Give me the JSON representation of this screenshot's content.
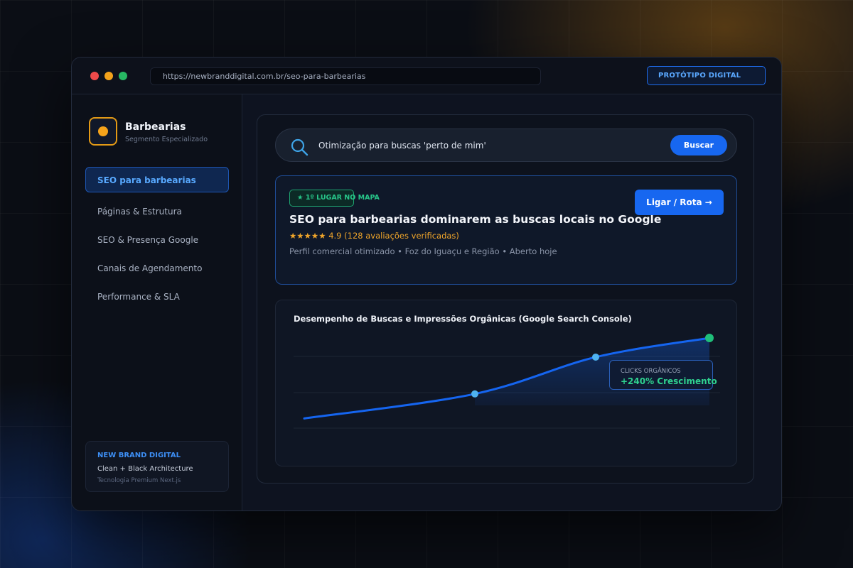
{
  "browser": {
    "url": "https://newbranddigital.com.br/seo-para-barbearias",
    "badge": "PROTÓTIPO DIGITAL"
  },
  "sidebar": {
    "brand_title": "Barbearias",
    "brand_subtitle": "Segmento Especializado",
    "items": [
      {
        "label": "SEO para barbearias",
        "active": true
      },
      {
        "label": "Páginas & Estrutura",
        "active": false
      },
      {
        "label": "SEO & Presença Google",
        "active": false
      },
      {
        "label": "Canais de Agendamento",
        "active": false
      },
      {
        "label": "Performance & SLA",
        "active": false
      }
    ],
    "footer": {
      "title": "NEW BRAND DIGITAL",
      "line1": "Clean + Black Architecture",
      "line2": "Tecnologia Premium Next.js"
    }
  },
  "search": {
    "query": "Otimização para buscas 'perto de mim'",
    "button": "Buscar"
  },
  "result": {
    "badge": "★ 1º LUGAR NO MAPA",
    "title": "SEO para barbearias dominarem as buscas locais no Google",
    "rating": "★★★★★ 4.9 (128 avaliações verificadas)",
    "meta": "Perfil comercial otimizado • Foz do Iguaçu e Região • Aberto hoje",
    "cta": "Ligar / Rota →"
  },
  "chart": {
    "title": "Desempenho de Buscas e Impressões Orgânicas (Google Search Console)",
    "callout_label": "CLICKS ORGÂNICOS",
    "callout_value": "+240% Crescimento"
  },
  "chart_data": {
    "type": "area",
    "title": "Desempenho de Buscas e Impressões Orgânicas (Google Search Console)",
    "x": [
      0,
      1,
      2,
      3
    ],
    "values": [
      8,
      40,
      88,
      113
    ],
    "ylim": [
      0,
      125
    ],
    "grid": true,
    "highlight_index": 3,
    "colors": {
      "line": "#1565f0",
      "point": "#4fb3f0",
      "endpoint": "#1fbf7a"
    }
  },
  "colors": {
    "accent": "#1767f0",
    "brand": "#f5a31b",
    "success": "#27c589"
  }
}
